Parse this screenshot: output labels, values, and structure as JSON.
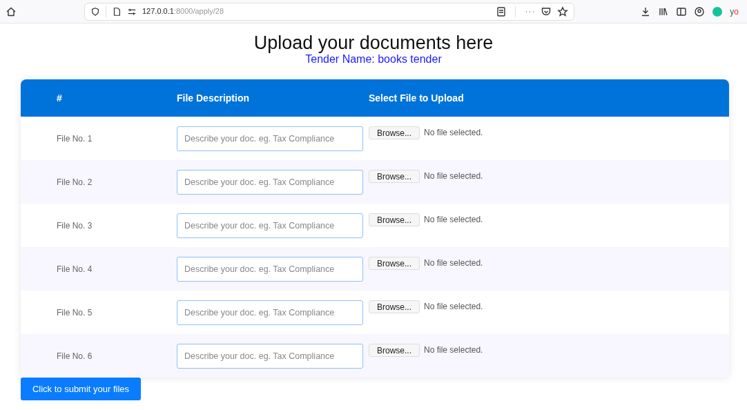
{
  "browser": {
    "url_host": "127.0.0.1",
    "url_path": ":8000/apply/28",
    "extension_label": [
      "y",
      "o"
    ]
  },
  "heading": {
    "title": "Upload your documents here",
    "subtitle": "Tender Name: books tender"
  },
  "table": {
    "columns": [
      "#",
      "File Description",
      "Select File to Upload"
    ],
    "rows": [
      {
        "label": "File No. 1",
        "placeholder": "Describe your doc. eg. Tax Compliance",
        "browse": "Browse...",
        "status": "No file selected."
      },
      {
        "label": "File No. 2",
        "placeholder": "Describe your doc. eg. Tax Compliance",
        "browse": "Browse...",
        "status": "No file selected."
      },
      {
        "label": "File No. 3",
        "placeholder": "Describe your doc. eg. Tax Compliance",
        "browse": "Browse...",
        "status": "No file selected."
      },
      {
        "label": "File No. 4",
        "placeholder": "Describe your doc. eg. Tax Compliance",
        "browse": "Browse...",
        "status": "No file selected."
      },
      {
        "label": "File No. 5",
        "placeholder": "Describe your doc. eg. Tax Compliance",
        "browse": "Browse...",
        "status": "No file selected."
      },
      {
        "label": "File No. 6",
        "placeholder": "Describe your doc. eg. Tax Compliance",
        "browse": "Browse...",
        "status": "No file selected."
      }
    ]
  },
  "submit_button": "Click to submit your files"
}
